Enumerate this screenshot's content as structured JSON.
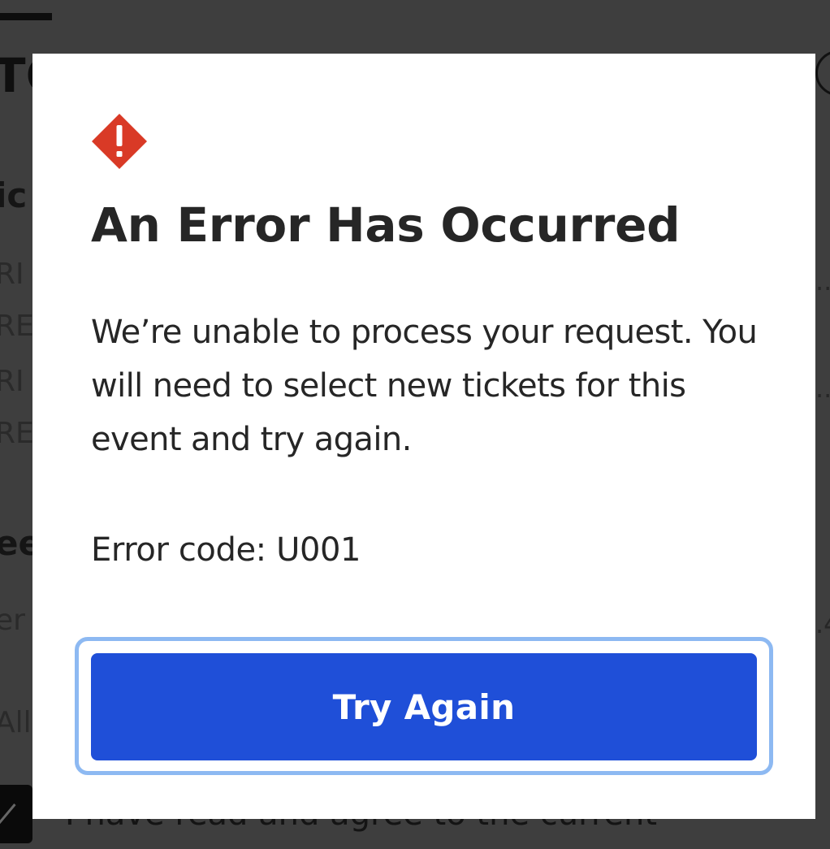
{
  "background": {
    "heading_fragment": "TC",
    "section_fragment": "ic",
    "row_fragments": [
      "RI",
      "RE",
      "RI",
      "RE"
    ],
    "section2_fragment": "ee",
    "row2_fragment": "er",
    "all_fragment": "All",
    "right_fragments": [
      "..",
      "..",
      ".4"
    ],
    "agree_text": "I have read and agree to the current"
  },
  "dialog": {
    "icon": "warning-diamond-icon",
    "icon_color": "#d93a26",
    "title": "An Error Has Occurred",
    "message": "We’re unable to process your request. You will need to select new tickets for this event and try again.",
    "error_code": "Error code: U001",
    "button_label": "Try Again",
    "button_color": "#1f4fd8",
    "focus_ring_color": "#8db9f2"
  }
}
